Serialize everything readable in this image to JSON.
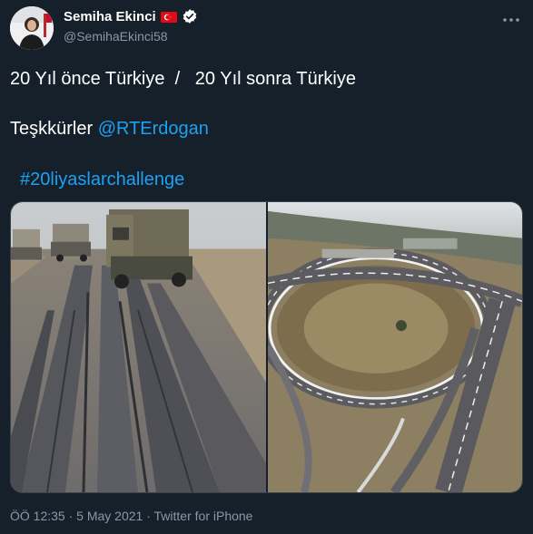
{
  "user": {
    "display_name": "Semiha Ekinci",
    "handle": "@SemihaEkinci58"
  },
  "tweet": {
    "line1": "20 Yıl önce Türkiye  /   20 Yıl sonra Türkiye",
    "line2_text": "Teşkkürler ",
    "line2_mention": "@RTErdogan",
    "hashtag": "#20liyaslarchallenge"
  },
  "meta": {
    "time": "ÖÖ 12:35",
    "separator1": " · ",
    "date": "5 May 2021",
    "separator2": " · ",
    "source": "Twitter for iPhone"
  },
  "colors": {
    "background": "#15202b",
    "link": "#1da1f2",
    "secondary_text": "#8899a6",
    "verified": "#ffffff",
    "flag_red": "#e30a17"
  },
  "icons": [
    "turkey-flag-icon",
    "verified-badge-icon",
    "more-options-icon"
  ]
}
